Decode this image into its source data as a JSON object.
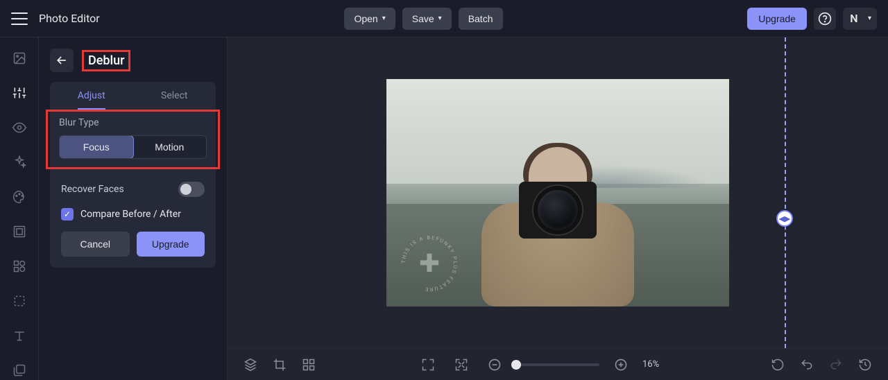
{
  "header": {
    "app_title": "Photo Editor",
    "open_label": "Open",
    "save_label": "Save",
    "batch_label": "Batch",
    "upgrade_label": "Upgrade",
    "avatar_initial": "N"
  },
  "panel": {
    "title": "Deblur",
    "tabs": {
      "adjust": "Adjust",
      "select": "Select"
    },
    "blur_type": {
      "label": "Blur Type",
      "options": {
        "focus": "Focus",
        "motion": "Motion"
      },
      "active": "focus"
    },
    "recover_faces": {
      "label": "Recover Faces",
      "enabled": false
    },
    "compare": {
      "label": "Compare Before / After",
      "checked": true
    },
    "buttons": {
      "cancel": "Cancel",
      "upgrade": "Upgrade"
    }
  },
  "canvas": {
    "compare_split_pct": 50,
    "watermark_text": "THIS IS A BEFUNKY PLUS FEATURE"
  },
  "bottombar": {
    "zoom_pct": "16%"
  },
  "colors": {
    "accent": "#8b93f8",
    "annotation": "#e53935"
  }
}
